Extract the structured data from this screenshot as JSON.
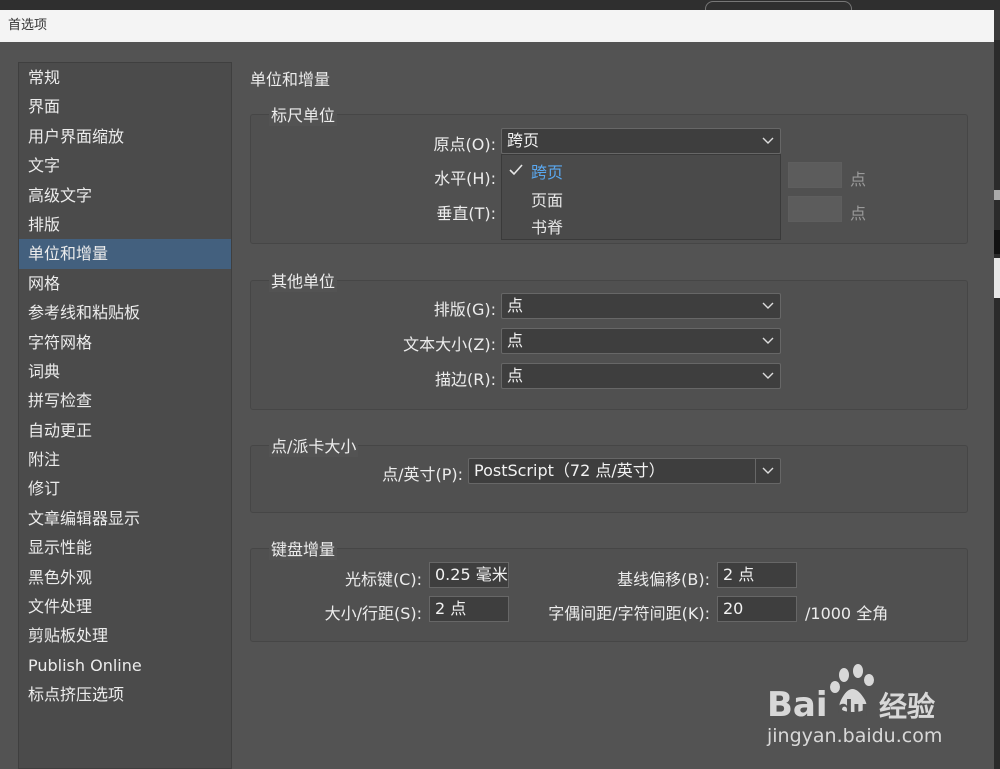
{
  "window": {
    "title": "首选项"
  },
  "sidebar": {
    "items": [
      {
        "label": "常规"
      },
      {
        "label": "界面"
      },
      {
        "label": "用户界面缩放"
      },
      {
        "label": "文字"
      },
      {
        "label": "高级文字"
      },
      {
        "label": "排版"
      },
      {
        "label": "单位和增量",
        "selected": true
      },
      {
        "label": "网格"
      },
      {
        "label": "参考线和粘贴板"
      },
      {
        "label": "字符网格"
      },
      {
        "label": "词典"
      },
      {
        "label": "拼写检查"
      },
      {
        "label": "自动更正"
      },
      {
        "label": "附注"
      },
      {
        "label": "修订"
      },
      {
        "label": "文章编辑器显示"
      },
      {
        "label": "显示性能"
      },
      {
        "label": "黑色外观"
      },
      {
        "label": "文件处理"
      },
      {
        "label": "剪贴板处理"
      },
      {
        "label": "Publish Online"
      },
      {
        "label": "标点挤压选项"
      }
    ],
    "selected_color": "#43607e"
  },
  "main": {
    "heading": "单位和增量",
    "ruler_units": {
      "legend": "标尺单位",
      "origin": {
        "label": "原点(O):",
        "value": "跨页"
      },
      "horizontal": {
        "label": "水平(H):",
        "unit": "点"
      },
      "vertical": {
        "label": "垂直(T):",
        "unit": "点"
      },
      "dropdown_options": [
        "跨页",
        "页面",
        "书脊"
      ],
      "dropdown_selected_color": "#5aa8f0"
    },
    "other_units": {
      "legend": "其他单位",
      "composition": {
        "label": "排版(G):",
        "value": "点"
      },
      "text_size": {
        "label": "文本大小(Z):",
        "value": "点"
      },
      "stroke": {
        "label": "描边(R):",
        "value": "点"
      }
    },
    "point_pica": {
      "legend": "点/派卡大小",
      "points_inch": {
        "label": "点/英寸(P):",
        "value": "PostScript（72 点/英寸）"
      }
    },
    "keyboard": {
      "legend": "键盘增量",
      "cursor_key": {
        "label": "光标键(C):",
        "value": "0.25 毫米"
      },
      "baseline_shift": {
        "label": "基线偏移(B):",
        "value": "2 点"
      },
      "size_leading": {
        "label": "大小/行距(S):",
        "value": "2 点"
      },
      "kerning": {
        "label": "字偶间距/字符间距(K):",
        "value": "20",
        "unit": "/1000 全角"
      }
    }
  },
  "watermark": {
    "brand": "Bai",
    "brand2": "du",
    "brand3": "经验",
    "url": "jingyan.baidu.com"
  }
}
